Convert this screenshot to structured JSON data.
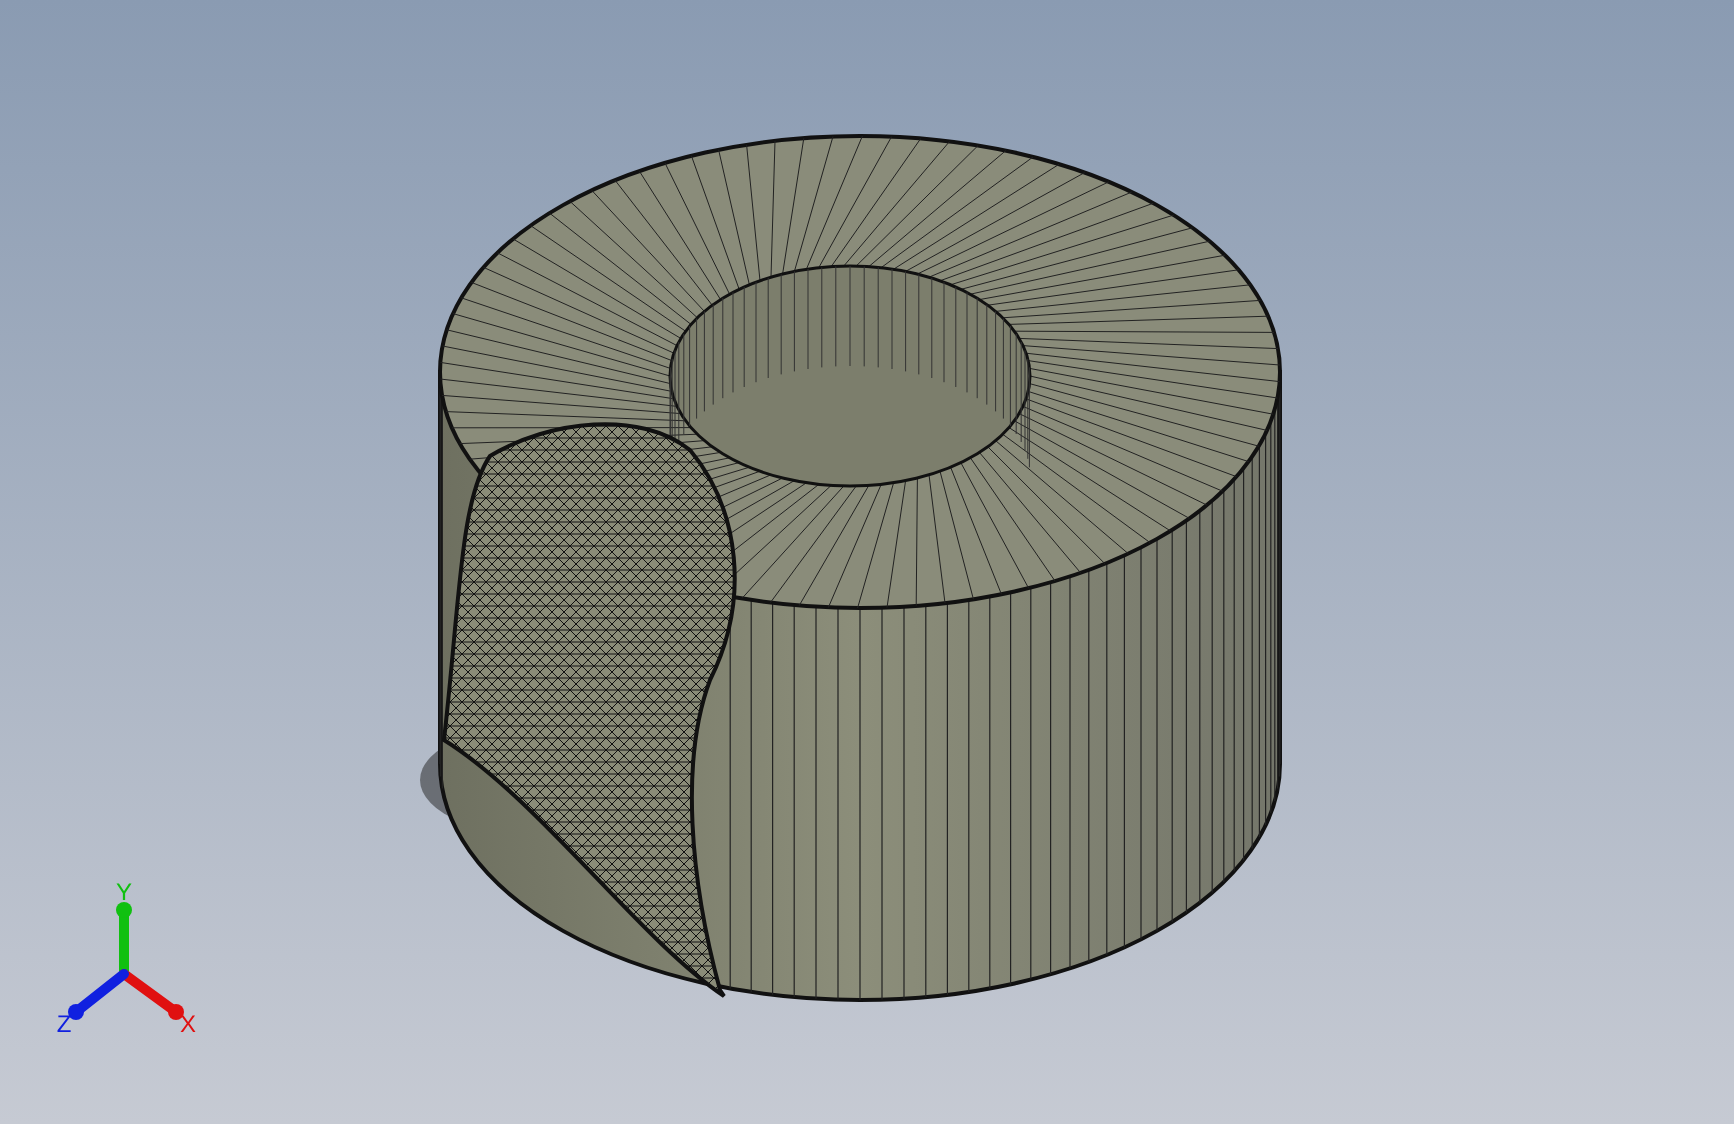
{
  "triad": {
    "axes": [
      {
        "kind": "y",
        "label": "Y"
      },
      {
        "kind": "x",
        "label": "X"
      },
      {
        "kind": "z",
        "label": "Z"
      }
    ]
  }
}
